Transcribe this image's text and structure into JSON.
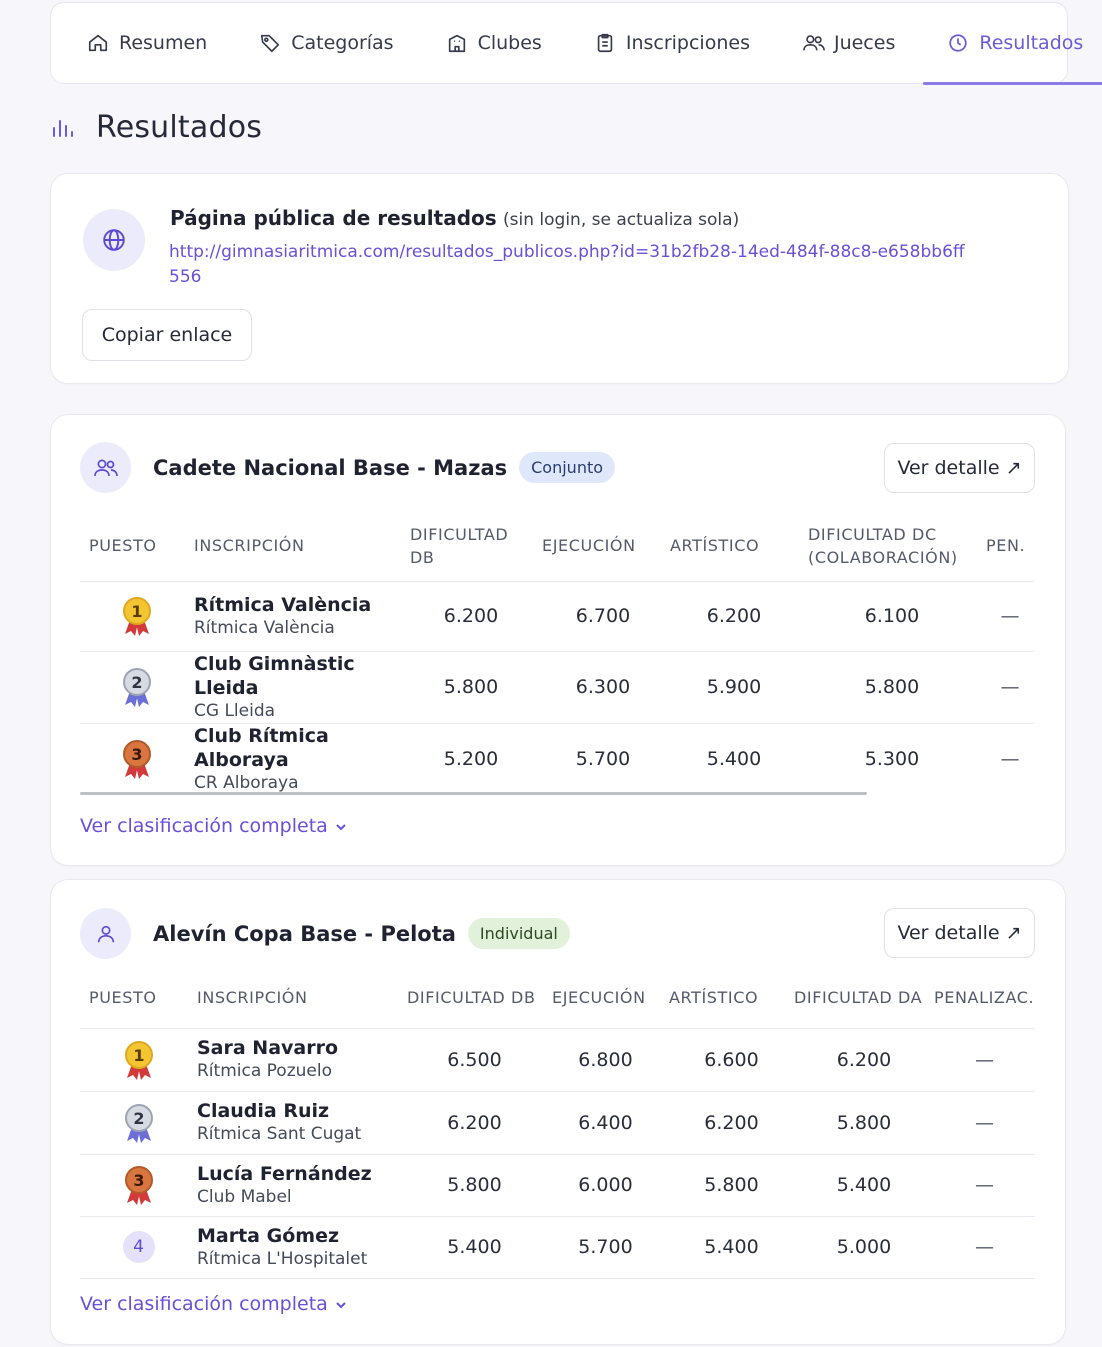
{
  "nav": {
    "tabs": [
      {
        "label": "Resumen",
        "icon": "home-icon"
      },
      {
        "label": "Categorías",
        "icon": "tag-icon"
      },
      {
        "label": "Clubes",
        "icon": "building-icon"
      },
      {
        "label": "Inscripciones",
        "icon": "clipboard-icon"
      },
      {
        "label": "Jueces",
        "icon": "users-icon"
      },
      {
        "label": "Resultados",
        "icon": "clock-icon"
      }
    ],
    "active": "Resultados",
    "accent": "#6b5bd6"
  },
  "page": {
    "title": "Resultados",
    "title_icon": "bar-chart-icon"
  },
  "public": {
    "title": "Página pública de resultados",
    "subtitle": "(sin login, se actualiza sola)",
    "url": "http://gimnasiaritmica.com/resultados_publicos.php?id=31b2fb28-14ed-484f-88c8-e658bb6ff556",
    "copy_label": "Copiar enlace",
    "icon": "globe-icon"
  },
  "categories": [
    {
      "title": "Cadete Nacional Base - Mazas",
      "badge": "Conjunto",
      "icon": "users-icon",
      "detail_label": "Ver detalle ↗",
      "columns": [
        "PUESTO",
        "INSCRIPCIÓN",
        "DIFICULTAD DB",
        "EJECUCIÓN",
        "ARTÍSTICO",
        "DIFICULTAD DC (COLABORACIÓN)",
        "PEN."
      ],
      "rows": [
        {
          "rank": "1",
          "name": "Rítmica València",
          "club": "Rítmica València",
          "db": "6.200",
          "ejec": "6.700",
          "art": "6.200",
          "dd": "6.100",
          "pen": "—"
        },
        {
          "rank": "2",
          "name": "Club Gimnàstic Lleida",
          "club": "CG Lleida",
          "db": "5.800",
          "ejec": "6.300",
          "art": "5.900",
          "dd": "5.800",
          "pen": "—"
        },
        {
          "rank": "3",
          "name": "Club Rítmica Alboraya",
          "club": "CR Alboraya",
          "db": "5.200",
          "ejec": "5.700",
          "art": "5.400",
          "dd": "5.300",
          "pen": "—"
        }
      ],
      "more_label": "Ver clasificación completa"
    },
    {
      "title": "Alevín Copa Base - Pelota",
      "badge": "Individual",
      "icon": "user-icon",
      "detail_label": "Ver detalle ↗",
      "columns": [
        "PUESTO",
        "INSCRIPCIÓN",
        "DIFICULTAD DB",
        "EJECUCIÓN",
        "ARTÍSTICO",
        "DIFICULTAD DA",
        "PENALIZAC."
      ],
      "rows": [
        {
          "rank": "1",
          "name": "Sara Navarro",
          "club": "Rítmica Pozuelo",
          "db": "6.500",
          "ejec": "6.800",
          "art": "6.600",
          "dd": "6.200",
          "pen": "—"
        },
        {
          "rank": "2",
          "name": "Claudia Ruiz",
          "club": "Rítmica Sant Cugat",
          "db": "6.200",
          "ejec": "6.400",
          "art": "6.200",
          "dd": "5.800",
          "pen": "—"
        },
        {
          "rank": "3",
          "name": "Lucía Fernández",
          "club": "Club Mabel",
          "db": "5.800",
          "ejec": "6.000",
          "art": "5.800",
          "dd": "5.400",
          "pen": "—"
        },
        {
          "rank": "4",
          "name": "Marta Gómez",
          "club": "Rítmica L'Hospitalet",
          "db": "5.400",
          "ejec": "5.700",
          "art": "5.400",
          "dd": "5.000",
          "pen": "—"
        }
      ],
      "more_label": "Ver clasificación completa"
    }
  ],
  "colors": {
    "gold": "#f3c533",
    "silver": "#c9cdd8",
    "bronze": "#d9753f",
    "ribbon_red": "#d23a3a",
    "ribbon_blue": "#6b6fd6"
  }
}
